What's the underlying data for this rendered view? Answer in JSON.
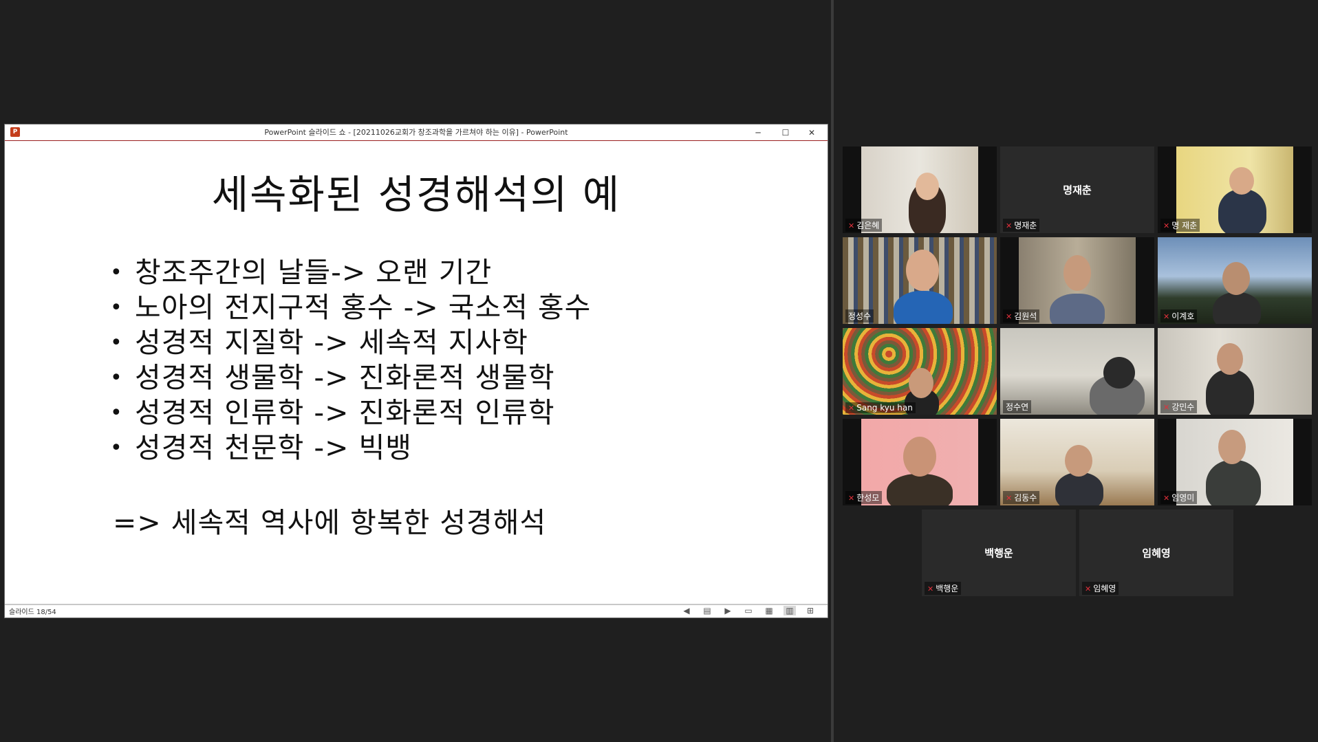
{
  "ppt": {
    "window_title": "PowerPoint 슬라이드 쇼 - [20211026교회가 창조과학을 가르쳐야 하는 이유] - PowerPoint",
    "logo_text": "P",
    "minimize": "─",
    "maximize": "☐",
    "close": "✕",
    "status": {
      "slide_counter": "슬라이드 18/54",
      "icons": [
        "◀",
        "▤",
        "▶",
        "▭",
        "▦",
        "▥",
        "⊞"
      ]
    }
  },
  "slide": {
    "title": "세속화된 성경해석의 예",
    "bullets": [
      "창조주간의 날들-> 오랜 기간",
      "노아의 전지구적 홍수 -> 국소적 홍수",
      "성경적 지질학 -> 세속적 지사학",
      "성경적 생물학 -> 진화론적 생물학",
      "성경적 인류학 -> 진화론적 인류학",
      "성경적 천문학 -> 빅뱅"
    ],
    "conclusion": "=> 세속적 역사에 항복한 성경해석"
  },
  "participants": [
    {
      "label": "김은혜",
      "center": ""
    },
    {
      "label": "명재춘",
      "center": "명재춘"
    },
    {
      "label": "명 재춘",
      "center": ""
    },
    {
      "label": "정성수",
      "center": ""
    },
    {
      "label": "김원석",
      "center": ""
    },
    {
      "label": "이계호",
      "center": ""
    },
    {
      "label": "Sang kyu han",
      "center": ""
    },
    {
      "label": "정수연",
      "center": ""
    },
    {
      "label": "강민수",
      "center": ""
    },
    {
      "label": "한성모",
      "center": ""
    },
    {
      "label": "김동수",
      "center": ""
    },
    {
      "label": "임영미",
      "center": ""
    },
    {
      "label": "백행운",
      "center": "백행운"
    },
    {
      "label": "임혜영",
      "center": "임혜영"
    }
  ],
  "colors": {
    "speaking_border": "#c6e85a",
    "mute_icon": "#e0303b",
    "ppt_accent": "#c43e1c"
  }
}
